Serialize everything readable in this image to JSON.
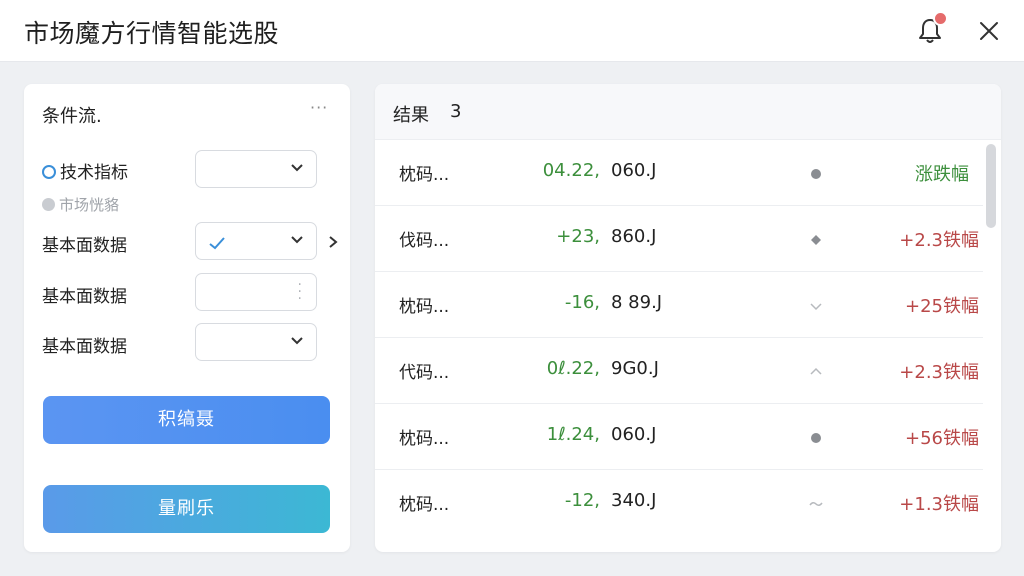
{
  "header": {
    "title": "市场魔方行情智能选股"
  },
  "left_panel": {
    "title": "条件流.",
    "more": "···",
    "options": [
      {
        "label": "技术指标",
        "state": "selected"
      },
      {
        "label": "市场恍貉",
        "state": "muted"
      },
      {
        "label": "基本面数据",
        "state": "normal"
      },
      {
        "label": "基本面数据",
        "state": "normal"
      },
      {
        "label": "基本面数据",
        "state": "normal"
      }
    ],
    "primary_button": "积缟聂",
    "secondary_button": "量刷乐"
  },
  "results": {
    "title": "结果",
    "count": "3",
    "rows": [
      {
        "code": "枕码...",
        "change": "04.22,",
        "price": "060.J",
        "marker": "dot",
        "pct": "涨跌幅",
        "pct_color": "green"
      },
      {
        "code": "伐码...",
        "change": "+23,",
        "price": "860.J",
        "marker": "diamond",
        "pct": "+2.3铁幅",
        "pct_color": "red"
      },
      {
        "code": "枕码...",
        "change": "-16,",
        "price": "8 89.J",
        "marker": "chevron-down",
        "pct": "+25铁幅",
        "pct_color": "red"
      },
      {
        "code": "代码...",
        "change": "0ℓ.22,",
        "price": "9G0.J",
        "marker": "chevron-up",
        "pct": "+2.3铁幅",
        "pct_color": "red"
      },
      {
        "code": "枕码...",
        "change": "1ℓ.24,",
        "price": "060.J",
        "marker": "dot",
        "pct": "+56铁幅",
        "pct_color": "red"
      },
      {
        "code": "枕码...",
        "change": "-12,",
        "price": "340.J",
        "marker": "tilde",
        "pct": "+1.3铁幅",
        "pct_color": "red"
      }
    ]
  },
  "colors": {
    "accent": "#4a8ef0",
    "up_red": "#b94848",
    "down_green": "#3c8f3c",
    "notification": "#e56b6b"
  }
}
